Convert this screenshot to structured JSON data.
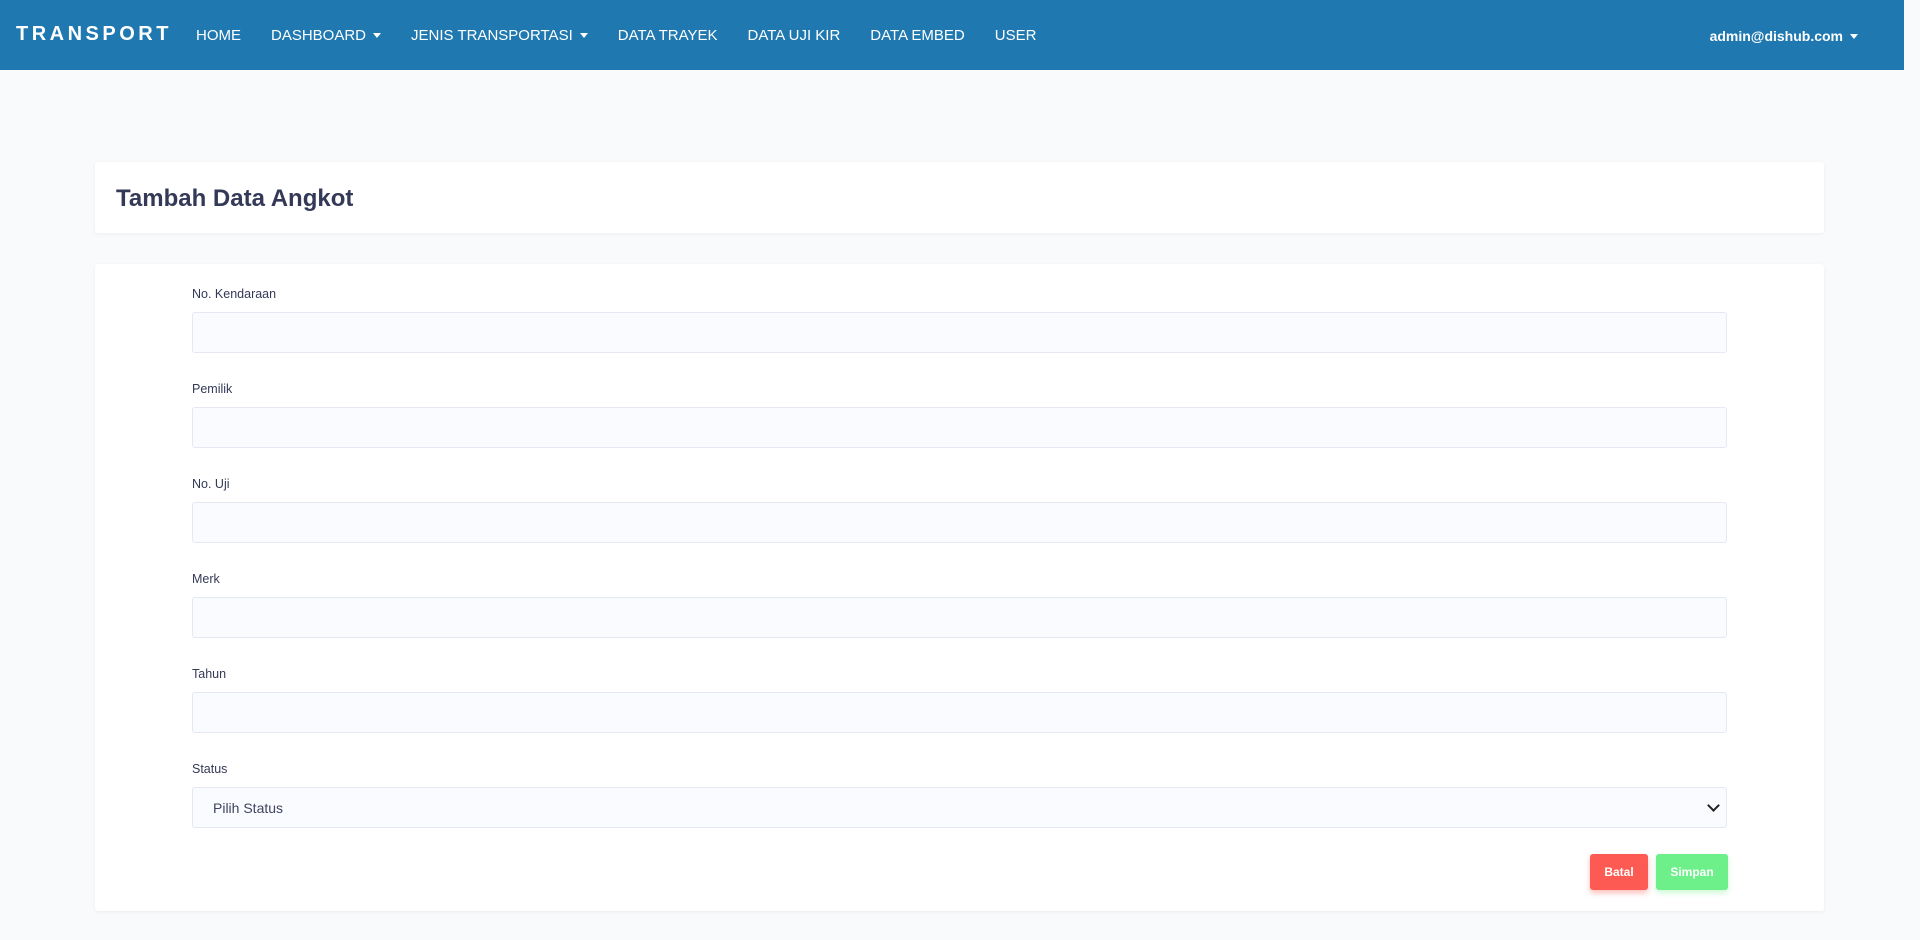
{
  "navbar": {
    "brand": "TRANSPORT",
    "items": [
      {
        "label": "HOME",
        "dropdown": false
      },
      {
        "label": "DASHBOARD",
        "dropdown": true
      },
      {
        "label": "JENIS TRANSPORTASI",
        "dropdown": true
      },
      {
        "label": "DATA TRAYEK",
        "dropdown": false
      },
      {
        "label": "DATA UJI KIR",
        "dropdown": false
      },
      {
        "label": "DATA EMBED",
        "dropdown": false
      },
      {
        "label": "USER",
        "dropdown": false
      }
    ],
    "user": "admin@dishub.com",
    "background": "#1f78b0"
  },
  "page": {
    "title": "Tambah Data Angkot"
  },
  "form": {
    "fields": [
      {
        "label": "No. Kendaraan",
        "value": "",
        "placeholder": ""
      },
      {
        "label": "Pemilik",
        "value": "",
        "placeholder": ""
      },
      {
        "label": "No. Uji",
        "value": "",
        "placeholder": ""
      },
      {
        "label": "Merk",
        "value": "",
        "placeholder": ""
      },
      {
        "label": "Tahun",
        "value": "",
        "placeholder": ""
      }
    ],
    "status": {
      "label": "Status",
      "selected": "Pilih Status"
    },
    "buttons": {
      "cancel": "Batal",
      "save": "Simpan"
    }
  },
  "colors": {
    "cancel": "#fd5a53",
    "save": "#6df08a",
    "page_background": "#f8fafb"
  }
}
